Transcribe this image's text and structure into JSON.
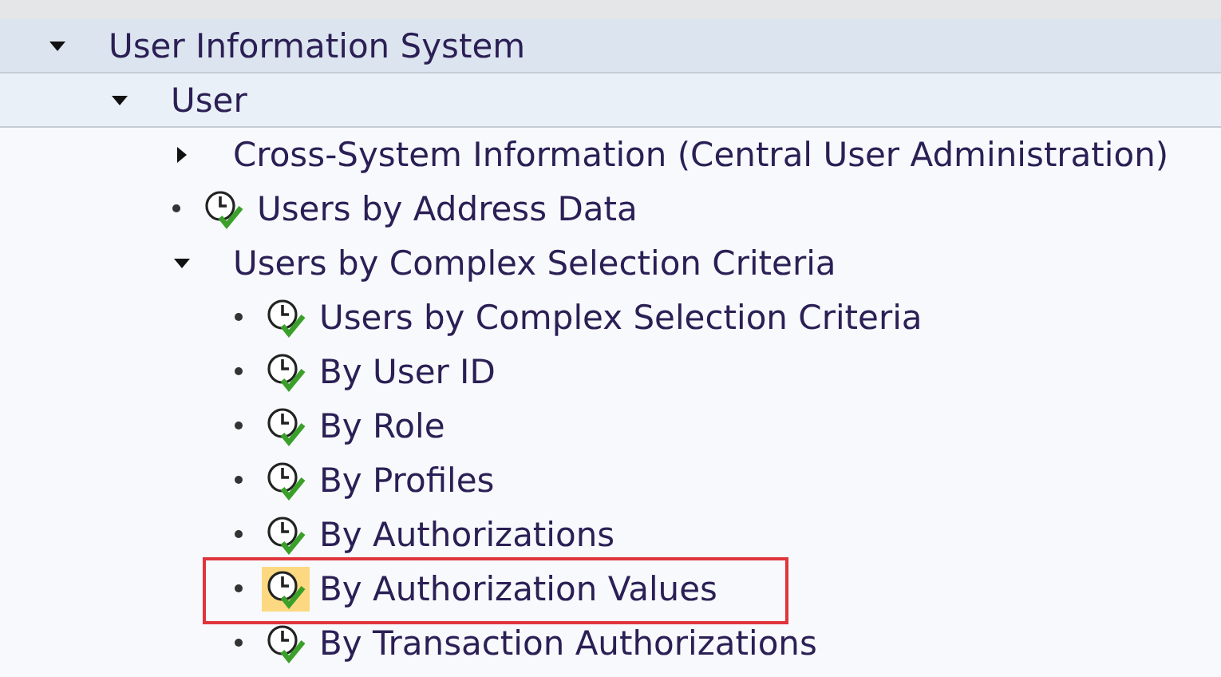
{
  "tree": [
    {
      "kind": "folder",
      "label": "User Information System",
      "expanded": true,
      "children": [
        {
          "kind": "folder",
          "label": "User",
          "expanded": true,
          "children": [
            {
              "kind": "folder",
              "label": "Cross-System Information (Central User Administration)",
              "expanded": false
            },
            {
              "kind": "transaction",
              "label": "Users by Address Data",
              "selected": false,
              "highlighted": false
            },
            {
              "kind": "folder",
              "label": "Users by Complex Selection Criteria",
              "expanded": true,
              "children": [
                {
                  "kind": "transaction",
                  "label": "Users by Complex Selection Criteria",
                  "selected": false,
                  "highlighted": false
                },
                {
                  "kind": "transaction",
                  "label": "By User ID",
                  "selected": false,
                  "highlighted": false
                },
                {
                  "kind": "transaction",
                  "label": "By Role",
                  "selected": false,
                  "highlighted": false
                },
                {
                  "kind": "transaction",
                  "label": "By Profiles",
                  "selected": false,
                  "highlighted": false
                },
                {
                  "kind": "transaction",
                  "label": "By Authorizations",
                  "selected": false,
                  "highlighted": false
                },
                {
                  "kind": "transaction",
                  "label": "By Authorization Values",
                  "selected": true,
                  "highlighted": true
                },
                {
                  "kind": "transaction",
                  "label": "By Transaction Authorizations",
                  "selected": false,
                  "highlighted": false
                }
              ]
            }
          ]
        }
      ]
    }
  ]
}
